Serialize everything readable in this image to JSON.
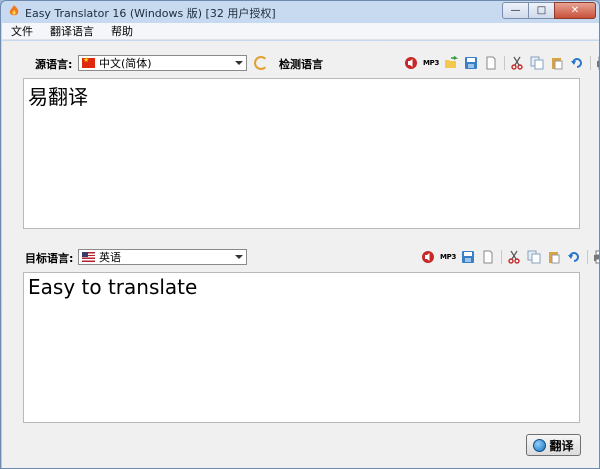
{
  "window": {
    "title": "Easy Translator 16 (Windows 版) [32 用户授权]",
    "controls": {
      "minimize": "—",
      "maximize": "□",
      "close": "✕"
    }
  },
  "menu": [
    "文件",
    "翻译语言",
    "帮助"
  ],
  "source": {
    "label": "源语言:",
    "language": "中文(简体)",
    "flag_icon": "china-flag-icon",
    "detect_label": "检测语言",
    "text": "易翻译"
  },
  "target": {
    "label": "目标语言:",
    "language": "英语",
    "flag_icon": "usa-flag-icon",
    "text": "Easy to translate"
  },
  "toolbar": {
    "mp3_label": "MP3",
    "icons": [
      "speaker-icon",
      "mp3-icon",
      "open-folder-icon",
      "save-icon",
      "new-document-icon",
      "cut-icon",
      "copy-icon",
      "paste-icon",
      "undo-icon",
      "print-icon"
    ]
  },
  "translate_button": {
    "label": "翻译",
    "icon": "globe-icon"
  },
  "colors": {
    "accent_red": "#c62828",
    "title_bar": "#c8daf0",
    "close_button": "#c8513b"
  }
}
